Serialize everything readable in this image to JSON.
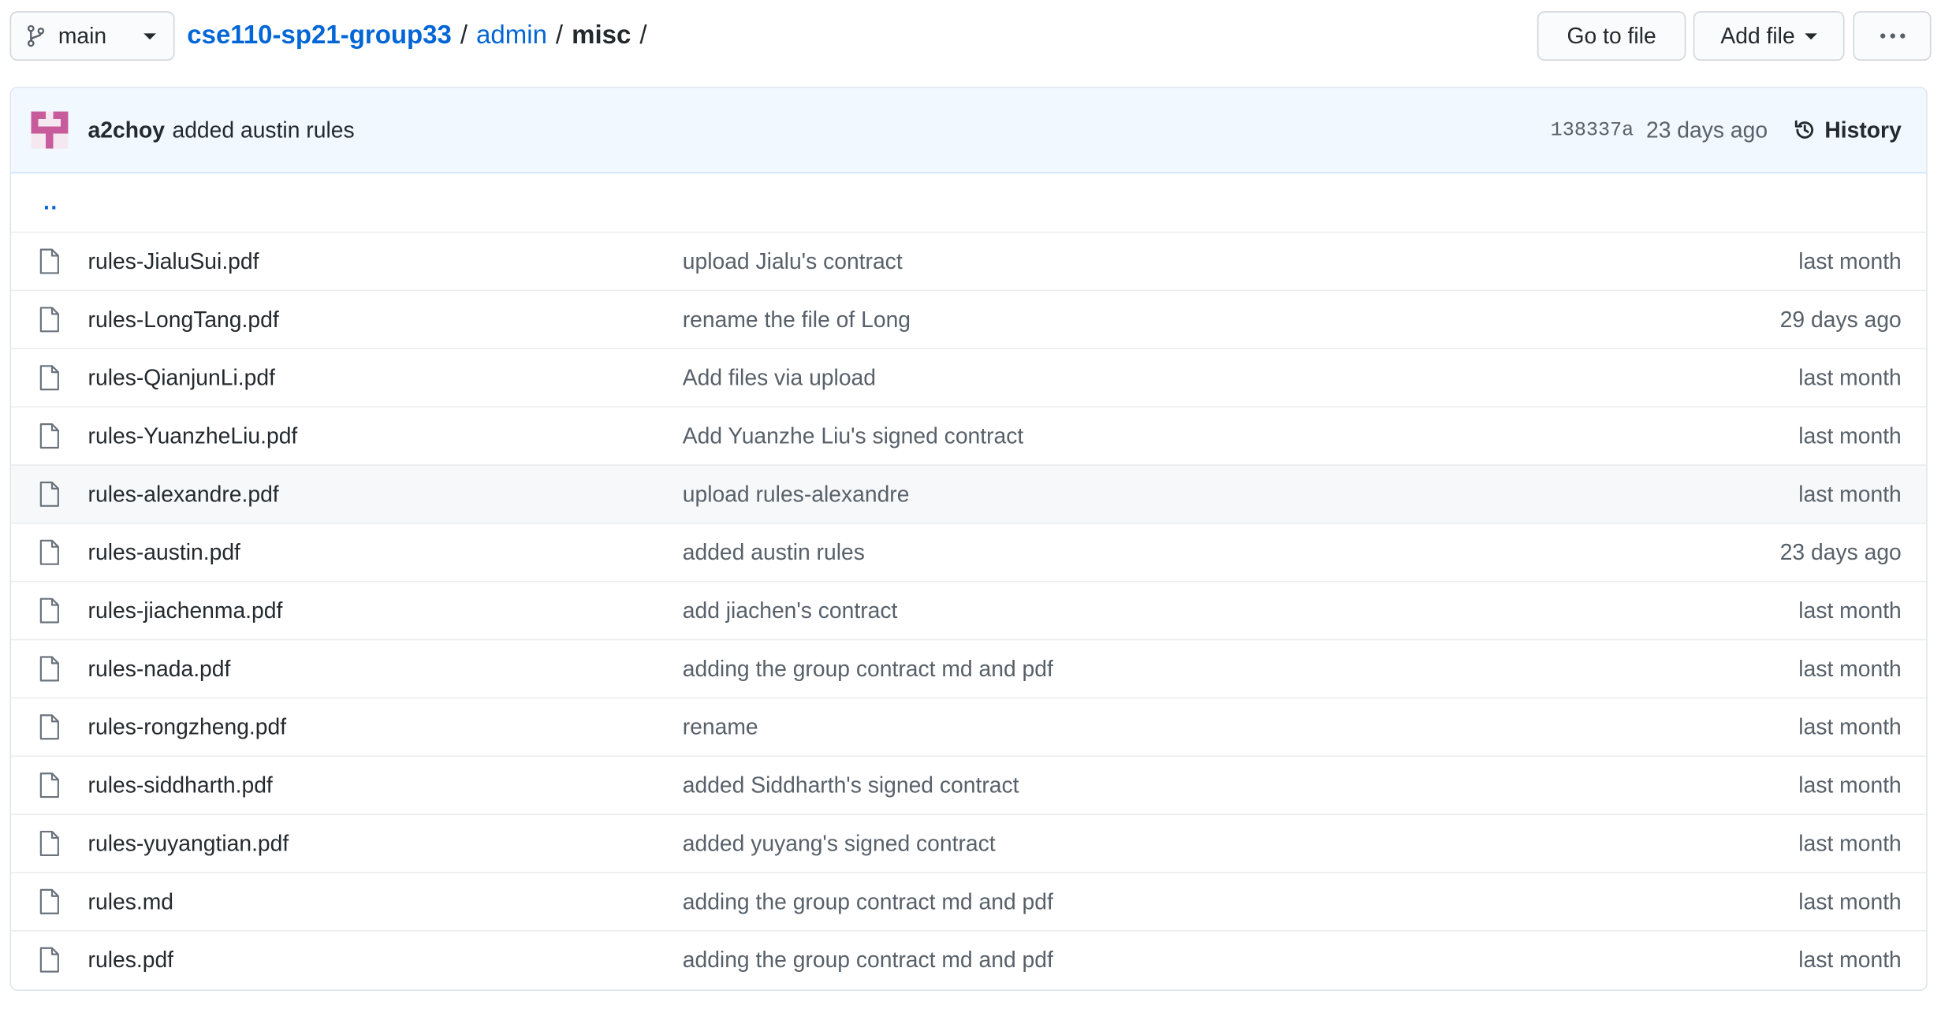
{
  "branch": {
    "icon": "git-branch-icon",
    "name": "main"
  },
  "breadcrumb": {
    "repo": "cse110-sp21-group33",
    "sep1": "/",
    "folder": "admin",
    "sep2": "/",
    "current": "misc",
    "sep3": "/"
  },
  "actions": {
    "go_to_file": "Go to file",
    "add_file": "Add file",
    "more_icon": "kebab-horizontal-icon"
  },
  "latest_commit": {
    "author": "a2choy",
    "message": "added austin rules",
    "sha": "138337a",
    "time": "23 days ago",
    "history_label": "History",
    "history_icon": "history-icon"
  },
  "parent_dir": "..",
  "files": [
    {
      "name": "rules-JialuSui.pdf",
      "message": "upload Jialu's contract",
      "age": "last month"
    },
    {
      "name": "rules-LongTang.pdf",
      "message": "rename the file of Long",
      "age": "29 days ago"
    },
    {
      "name": "rules-QianjunLi.pdf",
      "message": "Add files via upload",
      "age": "last month"
    },
    {
      "name": "rules-YuanzheLiu.pdf",
      "message": "Add Yuanzhe Liu's signed contract",
      "age": "last month"
    },
    {
      "name": "rules-alexandre.pdf",
      "message": "upload rules-alexandre",
      "age": "last month"
    },
    {
      "name": "rules-austin.pdf",
      "message": "added austin rules",
      "age": "23 days ago"
    },
    {
      "name": "rules-jiachenma.pdf",
      "message": "add jiachen's contract",
      "age": "last month"
    },
    {
      "name": "rules-nada.pdf",
      "message": "adding the group contract md and pdf",
      "age": "last month"
    },
    {
      "name": "rules-rongzheng.pdf",
      "message": "rename",
      "age": "last month"
    },
    {
      "name": "rules-siddharth.pdf",
      "message": "added Siddharth's signed contract",
      "age": "last month"
    },
    {
      "name": "rules-yuyangtian.pdf",
      "message": "added yuyang's signed contract",
      "age": "last month"
    },
    {
      "name": "rules.md",
      "message": "adding the group contract md and pdf",
      "age": "last month"
    },
    {
      "name": "rules.pdf",
      "message": "adding the group contract md and pdf",
      "age": "last month"
    }
  ],
  "colors": {
    "link": "#0366d6",
    "commit_bar_bg": "#f1f8ff",
    "avatar": "#c75b9b"
  }
}
